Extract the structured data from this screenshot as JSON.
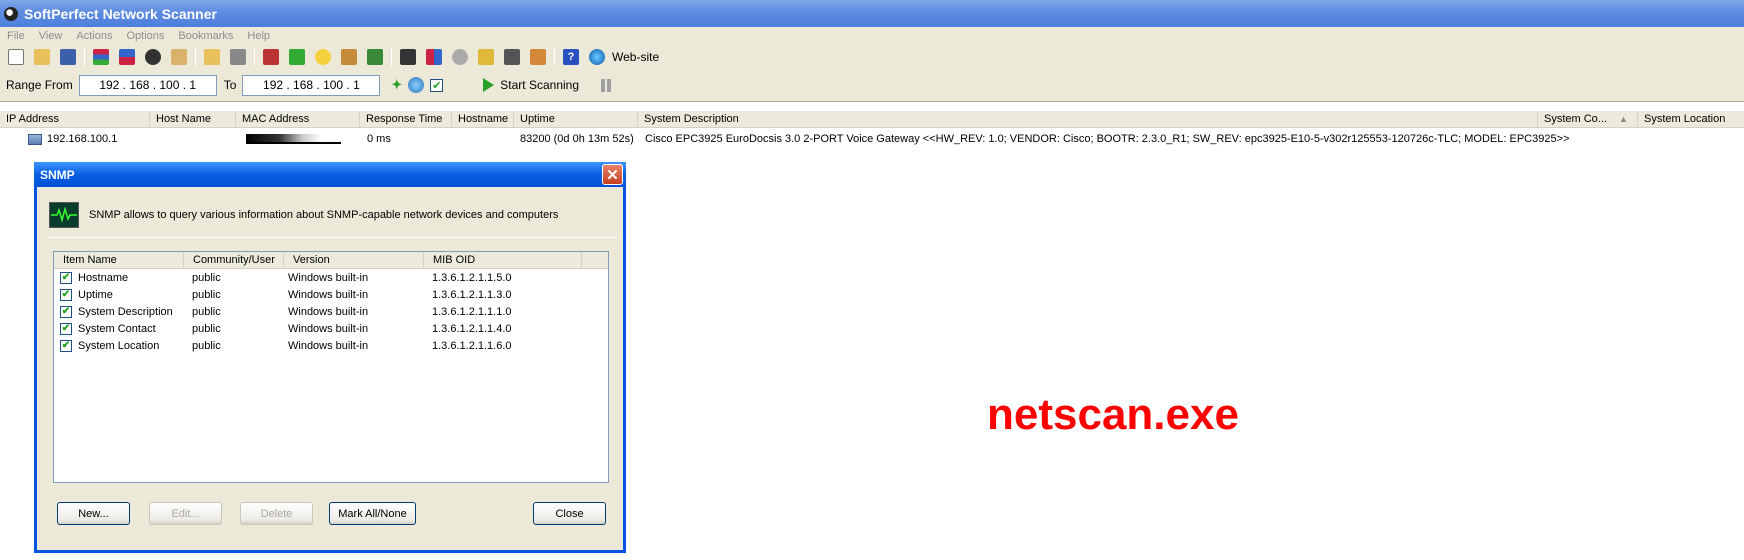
{
  "window": {
    "title": "SoftPerfect Network Scanner"
  },
  "menu": [
    "File",
    "View",
    "Actions",
    "Options",
    "Bookmarks",
    "Help"
  ],
  "toolbar": {
    "icons": [
      "new-file-icon",
      "open-folder-icon",
      "save-icon",
      "sep",
      "network-list-icon",
      "computer-list-icon",
      "find-icon",
      "clipboard-icon",
      "sep",
      "folder-icon",
      "filter-icon",
      "sep",
      "tools-icon",
      "resources-icon",
      "bulb-icon",
      "user-icon",
      "network-card-icon",
      "sep",
      "terminal-icon",
      "shapes-icon",
      "gear-icon",
      "monitor-icon",
      "screen-icon",
      "users-icon",
      "sep",
      "help-icon",
      "globe-icon"
    ],
    "website_label": "Web-site"
  },
  "range": {
    "from_label": "Range From",
    "from_value": "192  .  168  .  100  .   1",
    "to_label": "To",
    "to_value": "192  .  168  .  100  .   1",
    "start_label": "Start Scanning"
  },
  "main_list": {
    "columns": [
      "IP Address",
      "Host Name",
      "MAC Address",
      "Response Time",
      "Hostname",
      "Uptime",
      "System Description",
      "System Co...",
      "System Location"
    ],
    "row": {
      "ip": "192.168.100.1",
      "response": "0 ms",
      "uptime": "83200 (0d 0h 13m 52s)",
      "description": "Cisco EPC3925 EuroDocsis 3.0 2-PORT Voice Gateway <<HW_REV: 1.0; VENDOR: Cisco; BOOTR: 2.3.0_R1; SW_REV: epc3925-E10-5-v302r125553-120726c-TLC; MODEL: EPC3925>>"
    }
  },
  "watermark": "netscan.exe",
  "dialog": {
    "title": "SNMP",
    "info": "SNMP allows to query various information about SNMP-capable network devices and computers",
    "columns": [
      "Item Name",
      "Community/User",
      "Version",
      "MIB OID"
    ],
    "rows": [
      {
        "name": "Hostname",
        "community": "public",
        "version": "Windows built-in",
        "oid": "1.3.6.1.2.1.1.5.0"
      },
      {
        "name": "Uptime",
        "community": "public",
        "version": "Windows built-in",
        "oid": "1.3.6.1.2.1.1.3.0"
      },
      {
        "name": "System Description",
        "community": "public",
        "version": "Windows built-in",
        "oid": "1.3.6.1.2.1.1.1.0"
      },
      {
        "name": "System Contact",
        "community": "public",
        "version": "Windows built-in",
        "oid": "1.3.6.1.2.1.1.4.0"
      },
      {
        "name": "System Location",
        "community": "public",
        "version": "Windows built-in",
        "oid": "1.3.6.1.2.1.1.6.0"
      }
    ],
    "buttons": {
      "new": "New...",
      "edit": "Edit...",
      "delete": "Delete",
      "mark": "Mark All/None",
      "close": "Close"
    }
  }
}
